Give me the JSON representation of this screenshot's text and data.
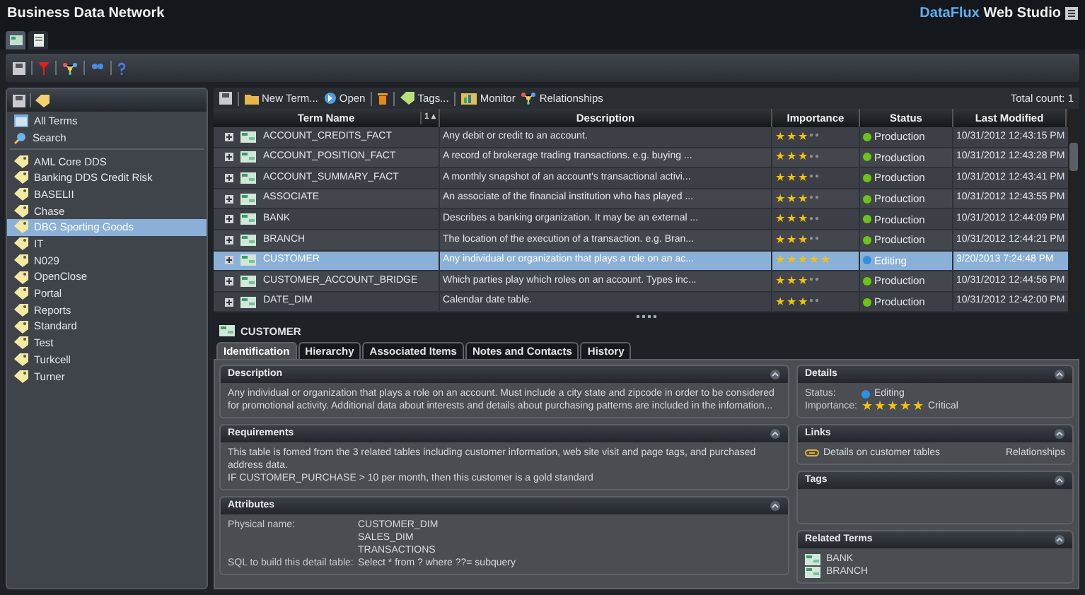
{
  "window": {
    "title": "Business Data Network",
    "brand_prefix": "DataFlux",
    "brand_suffix": "Web Studio"
  },
  "app_tabs": [
    {
      "kind": "terms",
      "selected": true
    },
    {
      "kind": "document",
      "selected": false
    }
  ],
  "sidebar": {
    "items": [
      {
        "kind": "all",
        "label": "All Terms",
        "selected": false
      },
      {
        "kind": "search",
        "label": "Search",
        "selected": false
      },
      {
        "kind": "tag",
        "label": "AML Core DDS",
        "selected": false
      },
      {
        "kind": "tag",
        "label": "Banking DDS Credit Risk",
        "selected": false
      },
      {
        "kind": "tag",
        "label": "BASELII",
        "selected": false
      },
      {
        "kind": "tag",
        "label": "Chase",
        "selected": false
      },
      {
        "kind": "tag",
        "label": "DBG Sporting Goods",
        "selected": true
      },
      {
        "kind": "tag",
        "label": "IT",
        "selected": false
      },
      {
        "kind": "tag",
        "label": "N029",
        "selected": false
      },
      {
        "kind": "tag",
        "label": "OpenClose",
        "selected": false
      },
      {
        "kind": "tag",
        "label": "Portal",
        "selected": false
      },
      {
        "kind": "tag",
        "label": "Reports",
        "selected": false
      },
      {
        "kind": "tag",
        "label": "Standard",
        "selected": false
      },
      {
        "kind": "tag",
        "label": "Test",
        "selected": false
      },
      {
        "kind": "tag",
        "label": "Turkcell",
        "selected": false
      },
      {
        "kind": "tag",
        "label": "Turner",
        "selected": false
      }
    ]
  },
  "toolbar": {
    "buttons": [
      {
        "kind": "new",
        "label": "New Term..."
      },
      {
        "kind": "open",
        "label": "Open"
      },
      {
        "kind": "delete"
      },
      {
        "kind": "tags",
        "label": "Tags..."
      },
      {
        "kind": "monitor",
        "label": "Monitor"
      },
      {
        "kind": "relationships",
        "label": "Relationships"
      }
    ],
    "total_count": "Total count: 1"
  },
  "table": {
    "columns": [
      "Term Name",
      "Description",
      "Importance",
      "Status",
      "Last Modified"
    ],
    "sort_indicator": "1 ▴",
    "rows": [
      {
        "name": "ACCOUNT_CREDITS_FACT",
        "description": "Any debit or credit to an account.",
        "stars": 3,
        "status": "Production",
        "color": "#6cc417",
        "modified": "10/31/2012 12:43:15 PM",
        "selected": false
      },
      {
        "name": "ACCOUNT_POSITION_FACT",
        "description": "A record of brokerage trading transactions. e.g. buying ...",
        "stars": 3,
        "status": "Production",
        "color": "#6cc417",
        "modified": "10/31/2012 12:43:28 PM",
        "selected": false
      },
      {
        "name": "ACCOUNT_SUMMARY_FACT",
        "description": "A monthly snapshot of an account's transactional activi...",
        "stars": 3,
        "status": "Production",
        "color": "#6cc417",
        "modified": "10/31/2012 12:43:41 PM",
        "selected": false
      },
      {
        "name": "ASSOCIATE",
        "description": "An associate of the financial institution who has played ...",
        "stars": 3,
        "status": "Production",
        "color": "#6cc417",
        "modified": "10/31/2012 12:43:55 PM",
        "selected": false
      },
      {
        "name": "BANK",
        "description": "Describes a banking organization. It may be an external ...",
        "stars": 3,
        "status": "Production",
        "color": "#6cc417",
        "modified": "10/31/2012 12:44:09 PM",
        "selected": false
      },
      {
        "name": "BRANCH",
        "description": "The location of the execution of a transaction. e.g. Bran...",
        "stars": 3,
        "status": "Production",
        "color": "#6cc417",
        "modified": "10/31/2012 12:44:21 PM",
        "selected": false
      },
      {
        "name": "CUSTOMER",
        "description": "Any individual or organization that plays a role on an ac...",
        "stars": 5,
        "status": "Editing",
        "color": "#2f8fe0",
        "modified": "3/20/2013 7:24:48 PM",
        "selected": true
      },
      {
        "name": "CUSTOMER_ACCOUNT_BRIDGE",
        "description": "Which parties play which roles on an account. Types inc...",
        "stars": 3,
        "status": "Production",
        "color": "#6cc417",
        "modified": "10/31/2012 12:44:56 PM",
        "selected": false
      },
      {
        "name": "DATE_DIM",
        "description": "Calendar date table.",
        "stars": 3,
        "status": "Production",
        "color": "#6cc417",
        "modified": "10/31/2012 12:42:00 PM",
        "selected": false
      }
    ]
  },
  "detail": {
    "title": "CUSTOMER",
    "tabs": [
      {
        "label": "Identification",
        "selected": true
      },
      {
        "label": "Hierarchy",
        "selected": false
      },
      {
        "label": "Associated Items",
        "selected": false
      },
      {
        "label": "Notes and Contacts",
        "selected": false
      },
      {
        "label": "History",
        "selected": false
      }
    ],
    "description": {
      "title": "Description",
      "text": "Any individual or organization that plays a role on an account. Must include a city state and zipcode in order to be considered for promotional activity.  Additional data about interests and details about purchasing patterns are included in the infomation..."
    },
    "requirements": {
      "title": "Requirements",
      "lines": [
        "This table is fomed from the 3 related tables including customer information, web site visit and page tags, and purchased address data.",
        "IF CUSTOMER_PURCHASE > 10 per month, then this customer is a gold standard"
      ]
    },
    "attributes": {
      "title": "Attributes",
      "physical_label": "Physical name:",
      "physical_names": [
        "CUSTOMER_DIM",
        "SALES_DIM",
        "TRANSACTIONS"
      ],
      "sql_label": "SQL to build this detail table:",
      "sql": "Select * from ? where ??= subquery"
    },
    "details": {
      "title": "Details",
      "status_label": "Status:",
      "status": "Editing",
      "color": "#2f8fe0",
      "importance_label": "Importance:",
      "stars": 5,
      "importance": "Critical"
    },
    "links": {
      "title": "Links",
      "link": "Details on customer tables",
      "type": "Relationships"
    },
    "tags": {
      "title": "Tags"
    },
    "related_terms": {
      "title": "Related Terms",
      "items": [
        "BANK",
        "BRANCH"
      ]
    }
  }
}
